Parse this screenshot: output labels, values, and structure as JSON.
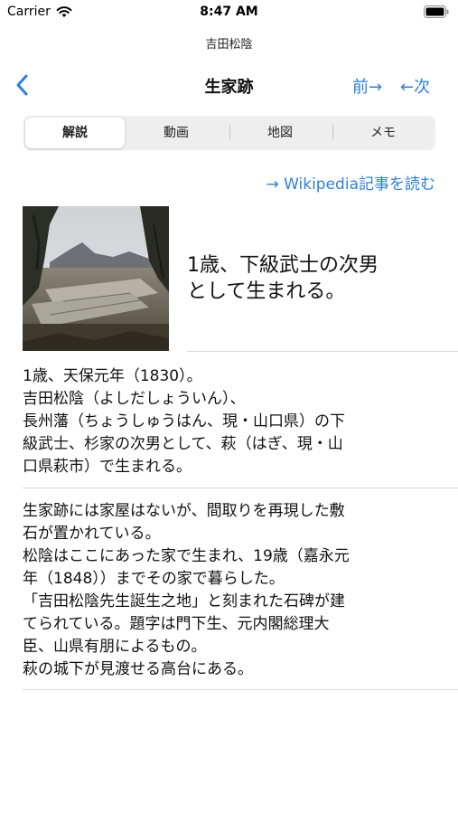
{
  "status_bar": {
    "carrier": "Carrier",
    "time": "8:47 AM"
  },
  "nav": {
    "subtitle": "吉田松陰",
    "title": "生家跡",
    "prev_label": "前→",
    "next_label": "←次"
  },
  "segments": [
    "解説",
    "動画",
    "地図",
    "メモ"
  ],
  "selected_segment": "解説",
  "wiki_link": "→ Wikipedia記事を読む",
  "hero": {
    "title_lines": [
      "1歳、下級武士の次男",
      "として生まれる。"
    ]
  },
  "section1_lines": [
    "1歳、天保元年（1830）。",
    "吉田松陰（よしだしょういん）、",
    "長州藩（ちょうしゅうはん、現・山口県）の下",
    "級武士、杉家の次男として、萩（はぎ、現・山",
    "口県萩市）で生まれる。"
  ],
  "section2_lines": [
    "生家跡には家屋はないが、間取りを再現した敷",
    "石が置かれている。",
    "松陰はここにあった家で生まれ、19歳（嘉永元",
    "年（1848））までその家で暮らした。",
    "「吉田松陰先生誕生之地」と刻まれた石碑が建",
    "てられている。題字は門下生、元内閣総理大",
    "臣、山県有朋によるもの。",
    "萩の城下が見渡せる高台にある。"
  ],
  "colors": {
    "accent": "#2f80d8",
    "divider": "#d7d7da",
    "segment_bg": "#eeeeef"
  },
  "icons": [
    "wifi-icon",
    "battery-icon",
    "chevron-left-icon"
  ]
}
